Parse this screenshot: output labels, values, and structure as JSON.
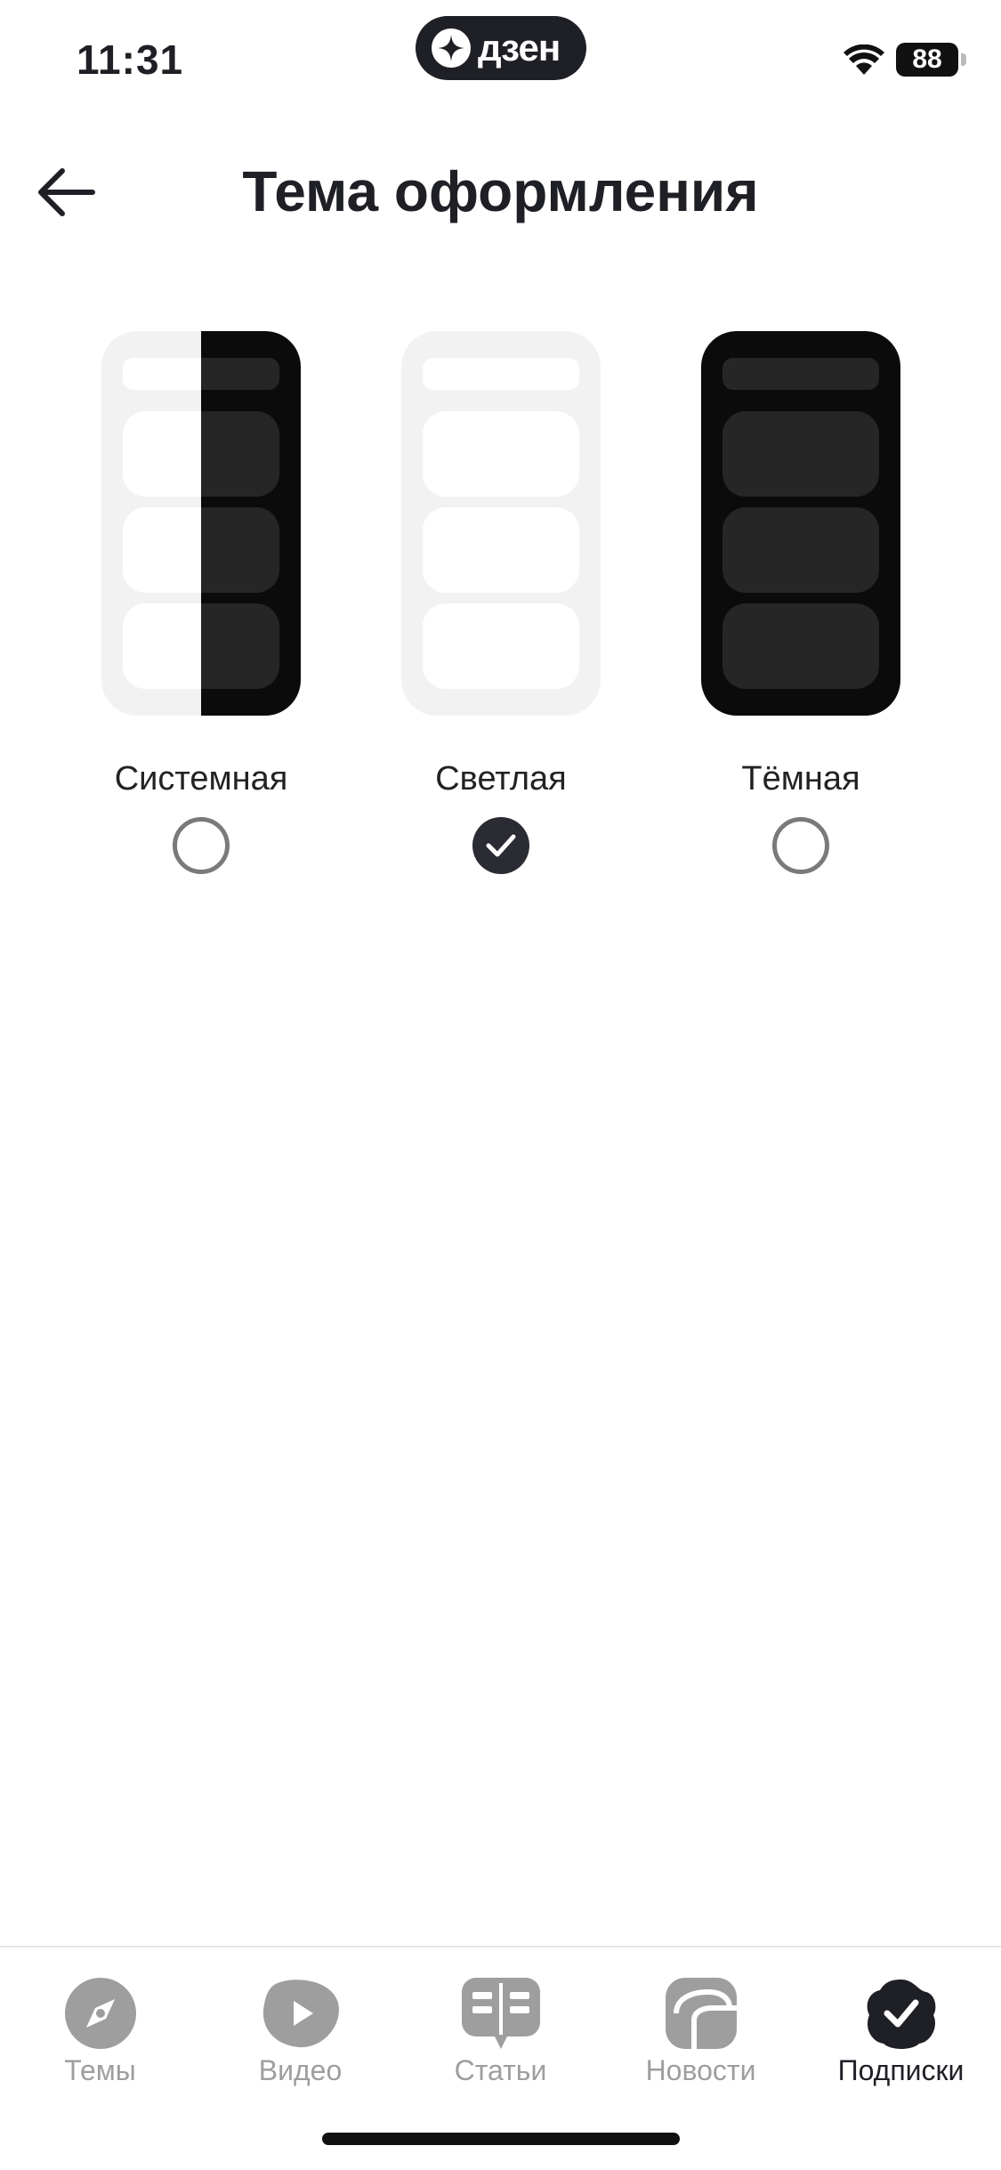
{
  "status": {
    "time": "11:31",
    "battery": "88",
    "brand": "дзен"
  },
  "header": {
    "title": "Тема оформления"
  },
  "themes": [
    {
      "label": "Системная",
      "selected": false
    },
    {
      "label": "Светлая",
      "selected": true
    },
    {
      "label": "Тёмная",
      "selected": false
    }
  ],
  "tabs": [
    {
      "label": "Темы",
      "icon": "compass-icon"
    },
    {
      "label": "Видео",
      "icon": "play-icon"
    },
    {
      "label": "Статьи",
      "icon": "book-icon"
    },
    {
      "label": "Новости",
      "icon": "news-icon"
    },
    {
      "label": "Подписки",
      "icon": "check-icon",
      "active": true
    }
  ],
  "colors": {
    "text": "#1f2026",
    "inactive": "#9e9e9e",
    "light_card": "#f2f2f2",
    "dark_card": "#0b0b0b",
    "dark_block": "#262626"
  }
}
